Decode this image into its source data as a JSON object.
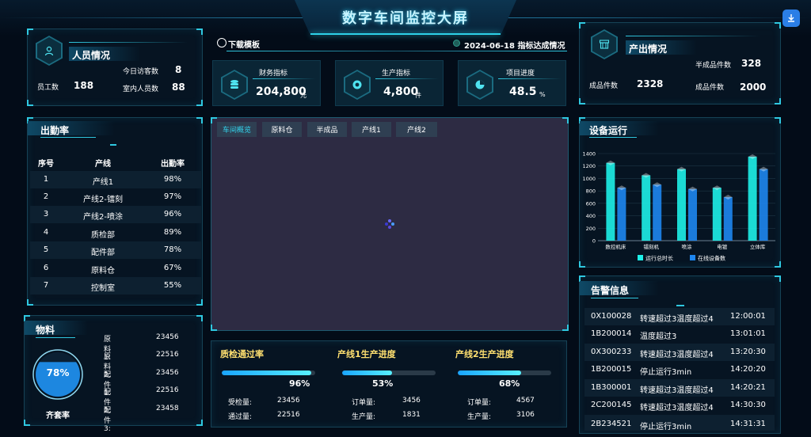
{
  "header": {
    "title": "数字车间监控大屏"
  },
  "personnel": {
    "title": "人员情况",
    "staff_label": "员工数",
    "staff_value": "188",
    "visitors_label": "今日访客数",
    "visitors_value": "8",
    "indoor_label": "室内人员数",
    "indoor_value": "88"
  },
  "toolbar": {
    "download_label": "下载模板",
    "date_label": "2024-06-18 指标达成情况"
  },
  "kpis": [
    {
      "label": "财务指标",
      "value": "204,800",
      "unit": "元"
    },
    {
      "label": "生产指标",
      "value": "4,800",
      "unit": "件"
    },
    {
      "label": "项目进度",
      "value": "48.5",
      "unit": "%"
    }
  ],
  "output": {
    "title": "产出情况",
    "finished_label": "成品件数",
    "finished_value": "2328",
    "semi_label": "半成品件数",
    "semi_value": "328",
    "finished2_label": "成品件数",
    "finished2_value": "2000"
  },
  "attendance": {
    "title": "出勤率",
    "headers": [
      "序号",
      "产线",
      "出勤率"
    ],
    "rows": [
      [
        "1",
        "产线1",
        "98%"
      ],
      [
        "2",
        "产线2-镭刻",
        "97%"
      ],
      [
        "3",
        "产线2-喷涂",
        "96%"
      ],
      [
        "4",
        "质检部",
        "89%"
      ],
      [
        "5",
        "配件部",
        "78%"
      ],
      [
        "6",
        "原料仓",
        "67%"
      ],
      [
        "7",
        "控制室",
        "55%"
      ]
    ]
  },
  "materials": {
    "title": "物料",
    "gauge_value": "78%",
    "gauge_fraction": 0.78,
    "gauge_label": "齐套率",
    "items": [
      {
        "name": "原料1:",
        "value": "23456"
      },
      {
        "name": "原料2:",
        "value": "22516"
      },
      {
        "name": "配件1:",
        "value": "23456"
      },
      {
        "name": "配件2:",
        "value": "22516"
      },
      {
        "name": "配件3:",
        "value": "23458"
      }
    ]
  },
  "center": {
    "tabs": [
      "车间概览",
      "原料仓",
      "半成品",
      "产线1",
      "产线2"
    ]
  },
  "progress": [
    {
      "title": "质检通过率",
      "percent": "96%",
      "fraction": 0.96,
      "l1": "受检量:",
      "v1": "23456",
      "l2": "通过量:",
      "v2": "22516"
    },
    {
      "title": "产线1生产进度",
      "percent": "53%",
      "fraction": 0.53,
      "l1": "订单量:",
      "v1": "3456",
      "l2": "生产量:",
      "v2": "1831"
    },
    {
      "title": "产线2生产进度",
      "percent": "68%",
      "fraction": 0.68,
      "l1": "订单量:",
      "v1": "4567",
      "l2": "生产量:",
      "v2": "3106"
    }
  ],
  "equipment": {
    "title": "设备运行"
  },
  "chart_data": {
    "type": "bar",
    "title": "设备运行",
    "categories": [
      "数控机床",
      "镭刻机",
      "喷涂",
      "电镀",
      "立体库"
    ],
    "series": [
      {
        "name": "运行总时长",
        "color": "#1ef0e8",
        "values": [
          1250,
          1050,
          1150,
          850,
          1350
        ]
      },
      {
        "name": "在线设备数",
        "color": "#1e86f0",
        "values": [
          850,
          900,
          830,
          700,
          1150
        ]
      }
    ],
    "ylim": [
      0,
      1400
    ],
    "yticks": [
      "0",
      "200",
      "400",
      "600",
      "800",
      "1000",
      "1200",
      "1400"
    ],
    "legend": "bottom",
    "grid": true
  },
  "alarms": {
    "title": "告警信息",
    "rows": [
      [
        "0X100028",
        "转速超过3温度超过4",
        "12:00:01"
      ],
      [
        "1B200014",
        "温度超过3",
        "13:01:01"
      ],
      [
        "0X300233",
        "转速超过3温度超过4",
        "13:20:30"
      ],
      [
        "1B200015",
        "停止运行3min",
        "14:20:20"
      ],
      [
        "1B300001",
        "转速超过3温度超过4",
        "14:20:21"
      ],
      [
        "2C200145",
        "转速超过3温度超过4",
        "14:30:30"
      ],
      [
        "2B234521",
        "停止运行3min",
        "14:31:31"
      ]
    ]
  },
  "colors": {
    "accent": "#2fc8e0",
    "panel_border": "#164256",
    "background": "#030c18"
  }
}
